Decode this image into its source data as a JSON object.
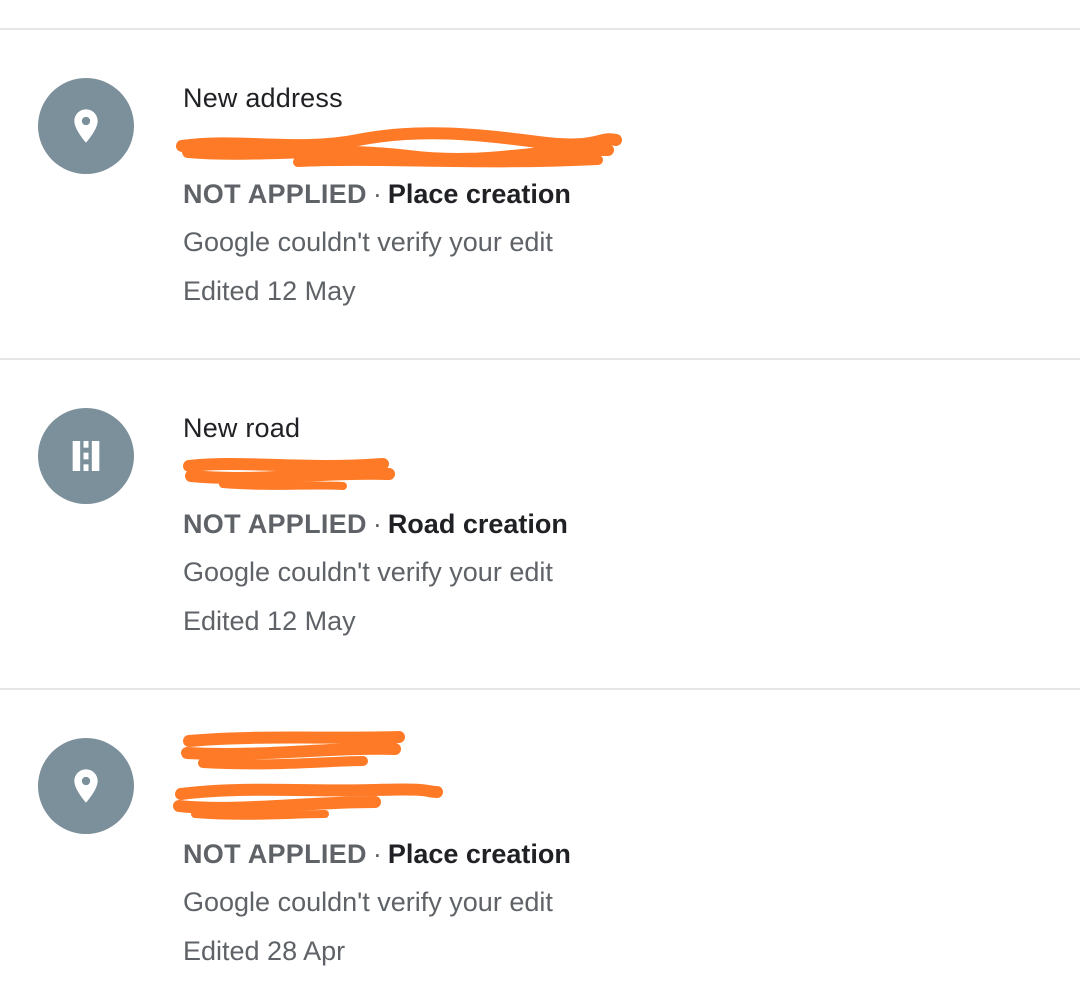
{
  "edits": [
    {
      "icon": "place-pin-icon",
      "title": "New address",
      "address": "",
      "status": "NOT APPLIED",
      "separator": "·",
      "kind": "Place creation",
      "message": "Google couldn't verify your edit",
      "edited": "Edited 12 May"
    },
    {
      "icon": "road-icon",
      "title": "New road",
      "address": "",
      "status": "NOT APPLIED",
      "separator": "·",
      "kind": "Road creation",
      "message": "Google couldn't verify your edit",
      "edited": "Edited 12 May"
    },
    {
      "icon": "place-pin-icon",
      "title": "",
      "address": "",
      "status": "NOT APPLIED",
      "separator": "·",
      "kind": "Place creation",
      "message": "Google couldn't verify your edit",
      "edited": "Edited 28 Apr"
    }
  ],
  "colors": {
    "avatar_bg": "#7b909b",
    "redaction": "#ff7a26",
    "divider": "#e6e6e6"
  }
}
